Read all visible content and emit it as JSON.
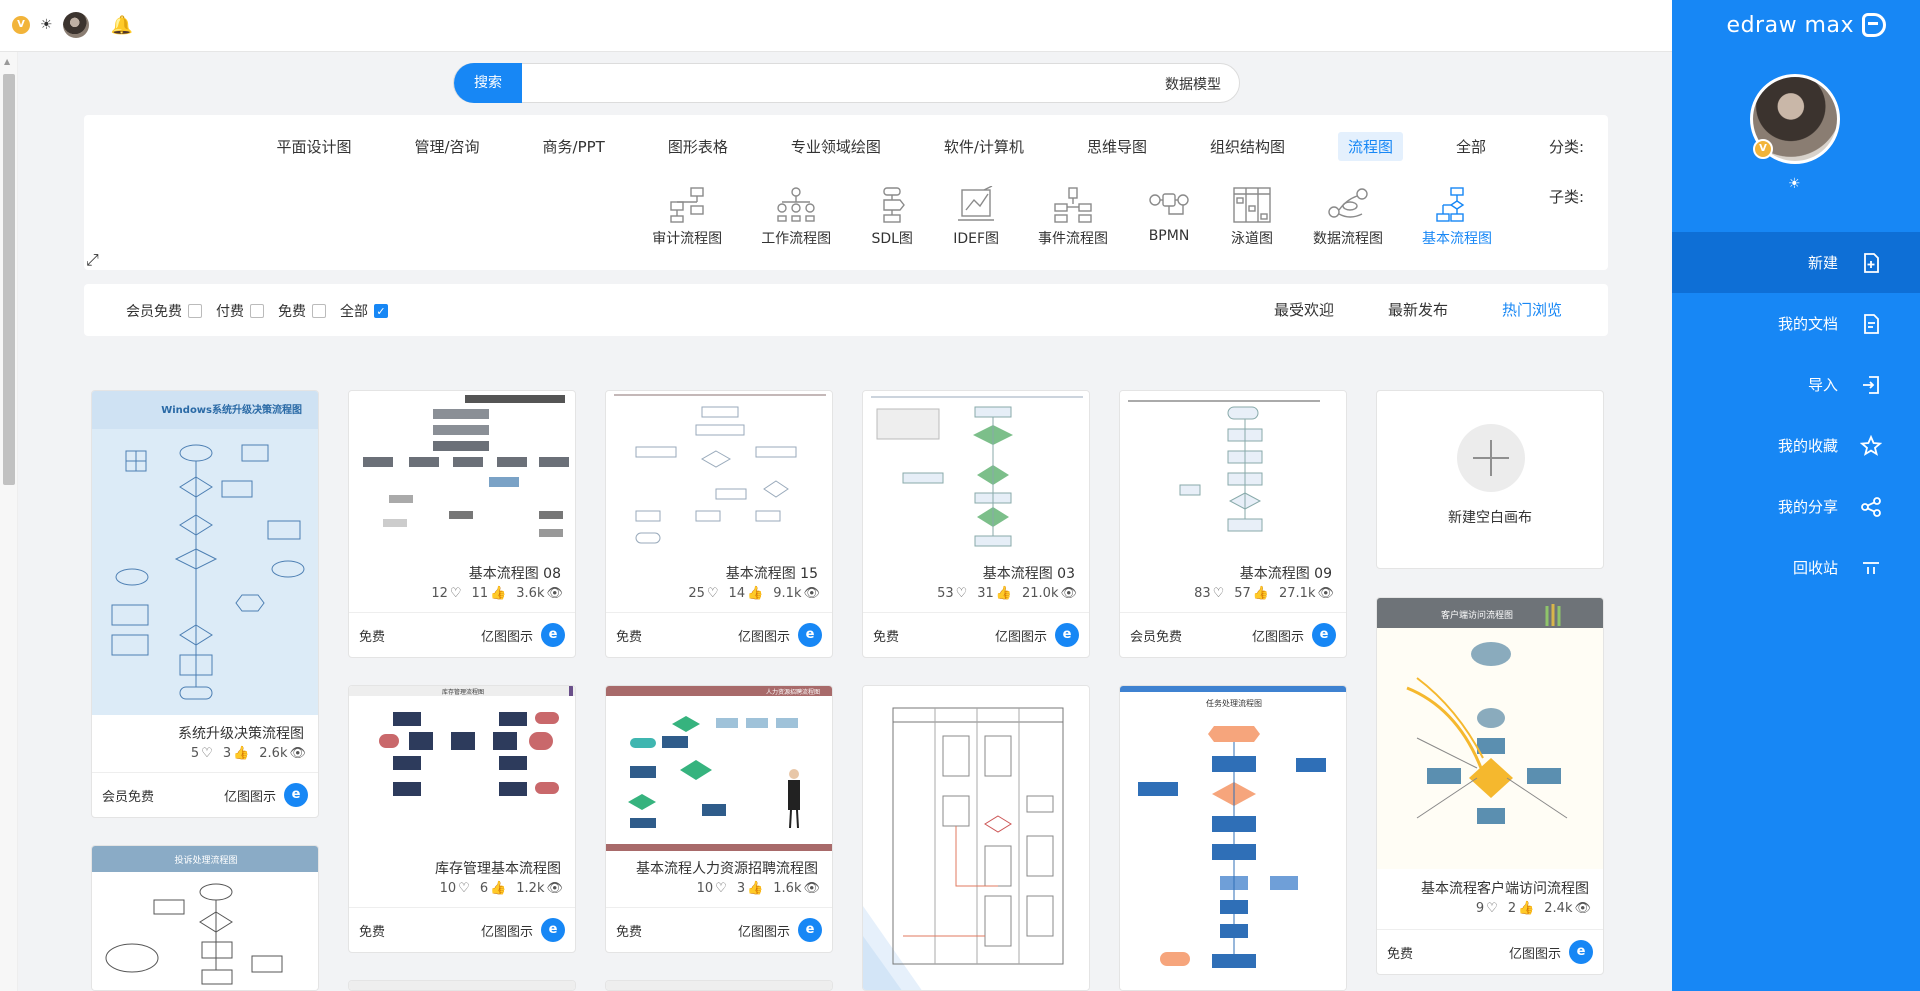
{
  "app": {
    "brand": "edraw max"
  },
  "sidebar": {
    "items": [
      {
        "label": "新建",
        "icon": "add-file-icon",
        "active": true
      },
      {
        "label": "我的文档",
        "icon": "document-icon"
      },
      {
        "label": "导入",
        "icon": "import-icon"
      },
      {
        "label": "我的收藏",
        "icon": "star-icon"
      },
      {
        "label": "我的分享",
        "icon": "share-icon"
      },
      {
        "label": "回收站",
        "icon": "trash-icon"
      }
    ]
  },
  "search": {
    "button_label": "搜索",
    "value": "数据模型"
  },
  "filters": {
    "category_label": "分类:",
    "subcategory_label": "子类:",
    "categories": [
      "全部",
      "流程图",
      "组织结构图",
      "思维导图",
      "软件/计算机",
      "专业领域绘图",
      "图形表格",
      "商务/PPT",
      "管理/咨询",
      "平面设计图"
    ],
    "active_category": "流程图",
    "subcategories": [
      "基本流程图",
      "数据流程图",
      "泳道图",
      "BPMN",
      "事件流程图",
      "IDEF图",
      "SDL图",
      "工作流程图",
      "审计流程图"
    ],
    "active_subcategory": "基本流程图"
  },
  "sort": {
    "tabs": [
      "热门浏览",
      "最新发布",
      "最受欢迎"
    ],
    "active": "热门浏览",
    "price_filters": [
      {
        "label": "全部",
        "checked": true
      },
      {
        "label": "免费",
        "checked": false
      },
      {
        "label": "付费",
        "checked": false
      },
      {
        "label": "会员免费",
        "checked": false
      }
    ]
  },
  "new_canvas": {
    "label": "新建空白画布"
  },
  "cards": [
    {
      "title": "基本流程图 09",
      "views": "27.1k",
      "likes": "57",
      "favs": "83",
      "author": "亿图图示",
      "price": "会员免费"
    },
    {
      "title": "基本流程图 03",
      "views": "21.0k",
      "likes": "31",
      "favs": "53",
      "author": "亿图图示",
      "price": "免费"
    },
    {
      "title": "基本流程图 15",
      "views": "9.1k",
      "likes": "14",
      "favs": "25",
      "author": "亿图图示",
      "price": "免费"
    },
    {
      "title": "基本流程图 08",
      "views": "3.6k",
      "likes": "11",
      "favs": "12",
      "author": "亿图图示",
      "price": "免费"
    },
    {
      "title": "系统升级决策流程图",
      "views": "2.6k",
      "likes": "3",
      "favs": "5",
      "author": "亿图图示",
      "price": "会员免费"
    },
    {
      "title": "基本流程客户端访问流程图",
      "views": "2.4k",
      "likes": "2",
      "favs": "9",
      "author": "亿图图示",
      "price": "免费"
    },
    {
      "title": "基本流程人力资源招聘流程图",
      "views": "1.6k",
      "likes": "3",
      "favs": "10",
      "author": "亿图图示",
      "price": "免费"
    },
    {
      "title": "库存管理基本流程图",
      "views": "1.2k",
      "likes": "6",
      "favs": "10",
      "author": "亿图图示",
      "price": "免费"
    }
  ],
  "thumb_titles": {
    "t6": "客户端访问流程图",
    "t9": "任务处理流程图",
    "t7": "人力资源招聘流程图",
    "t8": "库存管理流程图",
    "t5": "Windows系统升级决策流程图",
    "t11": "投诉处理流程图"
  },
  "colors": {
    "accent": "#1787f5",
    "sidebar": "#1787f5",
    "sidebar_active": "#0e6fd6"
  }
}
